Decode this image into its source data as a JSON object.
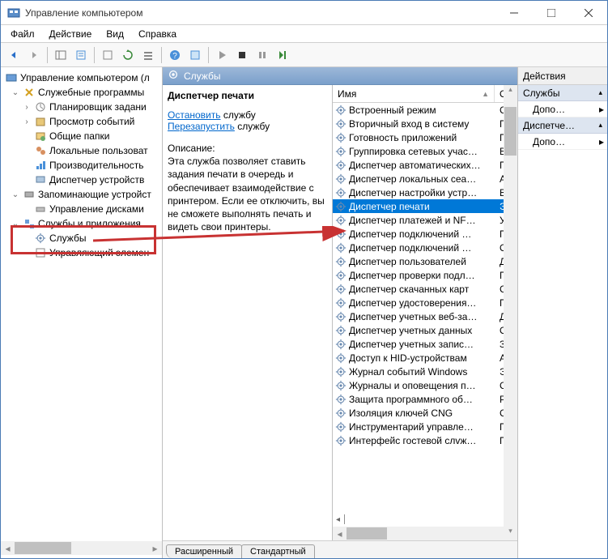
{
  "window": {
    "title": "Управление компьютером"
  },
  "menubar": [
    "Файл",
    "Действие",
    "Вид",
    "Справка"
  ],
  "tree": {
    "root": "Управление компьютером (л",
    "group1": "Служебные программы",
    "g1items": [
      "Планировщик задани",
      "Просмотр событий",
      "Общие папки",
      "Локальные пользоват",
      "Производительность",
      "Диспетчер устройств"
    ],
    "group2": "Запоминающие устройст",
    "g2items": [
      "Управление дисками"
    ],
    "group3": "Службы и приложения",
    "g3items": [
      "Службы",
      "Управляющий элемен"
    ]
  },
  "services_header": "Службы",
  "detail": {
    "title": "Диспетчер печати",
    "stop": "Остановить",
    "restart": "Перезапустить",
    "svc_word": " службу",
    "desc_label": "Описание:",
    "desc": "Эта служба позволяет ставить задания печати в очередь и обеспечивает взаимодействие с принтером. Если ее отключить, вы не сможете выполнять печать и видеть свои принтеры."
  },
  "columns": {
    "name": "Имя",
    "status": "О"
  },
  "services": [
    {
      "n": "Встроенный режим",
      "s": "С."
    },
    {
      "n": "Вторичный вход в систему",
      "s": "П"
    },
    {
      "n": "Готовность приложений",
      "s": "П"
    },
    {
      "n": "Группировка сетевых учас…",
      "s": "В:"
    },
    {
      "n": "Диспетчер автоматических…",
      "s": "П"
    },
    {
      "n": "Диспетчер локальных сеа…",
      "s": "А"
    },
    {
      "n": "Диспетчер настройки устр…",
      "s": "В:"
    },
    {
      "n": "Диспетчер печати",
      "s": "Эт",
      "sel": true
    },
    {
      "n": "Диспетчер платежей и NF…",
      "s": "У"
    },
    {
      "n": "Диспетчер подключений …",
      "s": "П"
    },
    {
      "n": "Диспетчер подключений …",
      "s": "О"
    },
    {
      "n": "Диспетчер пользователей",
      "s": "Д"
    },
    {
      "n": "Диспетчер проверки подл…",
      "s": "П"
    },
    {
      "n": "Диспетчер скачанных карт",
      "s": "С."
    },
    {
      "n": "Диспетчер удостоверения…",
      "s": "П"
    },
    {
      "n": "Диспетчер учетных веб-за…",
      "s": "Д"
    },
    {
      "n": "Диспетчер учетных данных",
      "s": "О"
    },
    {
      "n": "Диспетчер учетных запис…",
      "s": "З."
    },
    {
      "n": "Доступ к HID-устройствам",
      "s": "А"
    },
    {
      "n": "Журнал событий Windows",
      "s": "Эт"
    },
    {
      "n": "Журналы и оповещения п…",
      "s": "С."
    },
    {
      "n": "Защита программного об…",
      "s": "Р."
    },
    {
      "n": "Изоляция ключей CNG",
      "s": "С."
    },
    {
      "n": "Инструментарий управле…",
      "s": "П"
    },
    {
      "n": "Интерфейс гостевой слvж…",
      "s": "П"
    }
  ],
  "tabs": [
    "Расширенный",
    "Стандартный"
  ],
  "actions": {
    "header": "Действия",
    "sec1": "Службы",
    "item1": "Допо…",
    "sec2": "Диспетче…",
    "item2": "Допо…"
  }
}
